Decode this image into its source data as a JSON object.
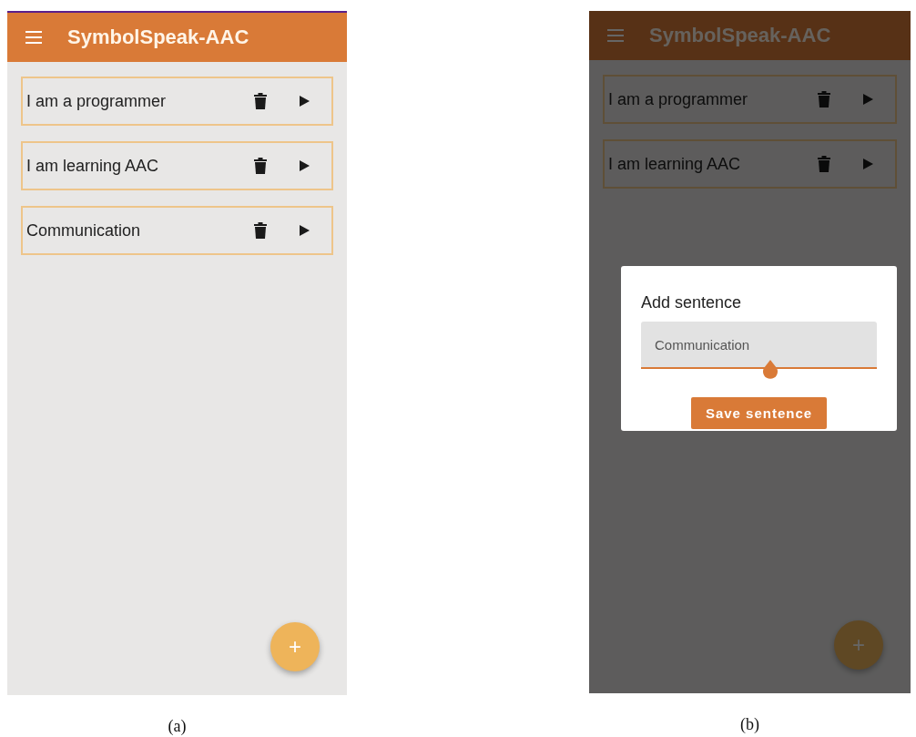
{
  "panels": [
    {
      "app_bar": {
        "title": "SymbolSpeak-AAC"
      },
      "sentences": [
        {
          "text": "I am a programmer"
        },
        {
          "text": "I am learning AAC"
        },
        {
          "text": "Communication"
        }
      ],
      "fab": "+",
      "dimmed": false,
      "caption": "(a)"
    },
    {
      "app_bar": {
        "title": "SymbolSpeak-AAC"
      },
      "sentences": [
        {
          "text": "I am a programmer"
        },
        {
          "text": "I am learning AAC"
        }
      ],
      "fab": "+",
      "dimmed": true,
      "dialog": {
        "title": "Add sentence",
        "field_value": "Communication",
        "button": "Save sentence"
      },
      "caption": "(b)"
    }
  ]
}
